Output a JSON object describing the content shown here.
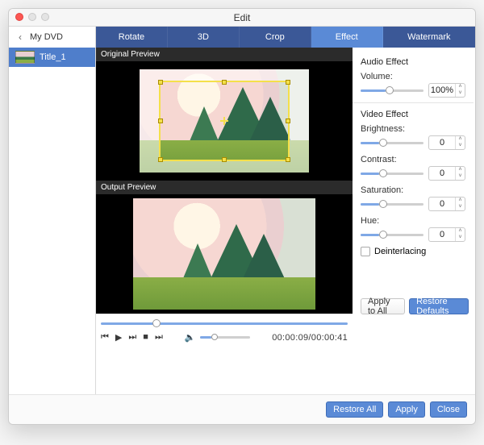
{
  "window": {
    "title": "Edit"
  },
  "crumb": {
    "name": "My DVD"
  },
  "sidebar": {
    "items": [
      {
        "label": "Title_1"
      }
    ]
  },
  "tabs": [
    {
      "label": "Rotate"
    },
    {
      "label": "3D"
    },
    {
      "label": "Crop"
    },
    {
      "label": "Effect"
    },
    {
      "label": "Watermark"
    }
  ],
  "activeTab": 3,
  "preview": {
    "original_hdr": "Original Preview",
    "output_hdr": "Output Preview"
  },
  "playback": {
    "position_pct": 21,
    "time": "00:00:09/00:00:41",
    "volume_pct": 22
  },
  "audio": {
    "section": "Audio Effect",
    "volume_label": "Volume:",
    "volume_pct": 40,
    "volume_value": "100%"
  },
  "video": {
    "section": "Video Effect",
    "brightness_label": "Brightness:",
    "brightness_pct": 30,
    "brightness_value": "0",
    "contrast_label": "Contrast:",
    "contrast_pct": 30,
    "contrast_value": "0",
    "saturation_label": "Saturation:",
    "saturation_pct": 30,
    "saturation_value": "0",
    "hue_label": "Hue:",
    "hue_pct": 30,
    "hue_value": "0",
    "deint_label": "Deinterlacing"
  },
  "buttons": {
    "apply_all": "Apply to All",
    "restore_defaults": "Restore Defaults",
    "restore_all": "Restore All",
    "apply": "Apply",
    "close": "Close"
  }
}
